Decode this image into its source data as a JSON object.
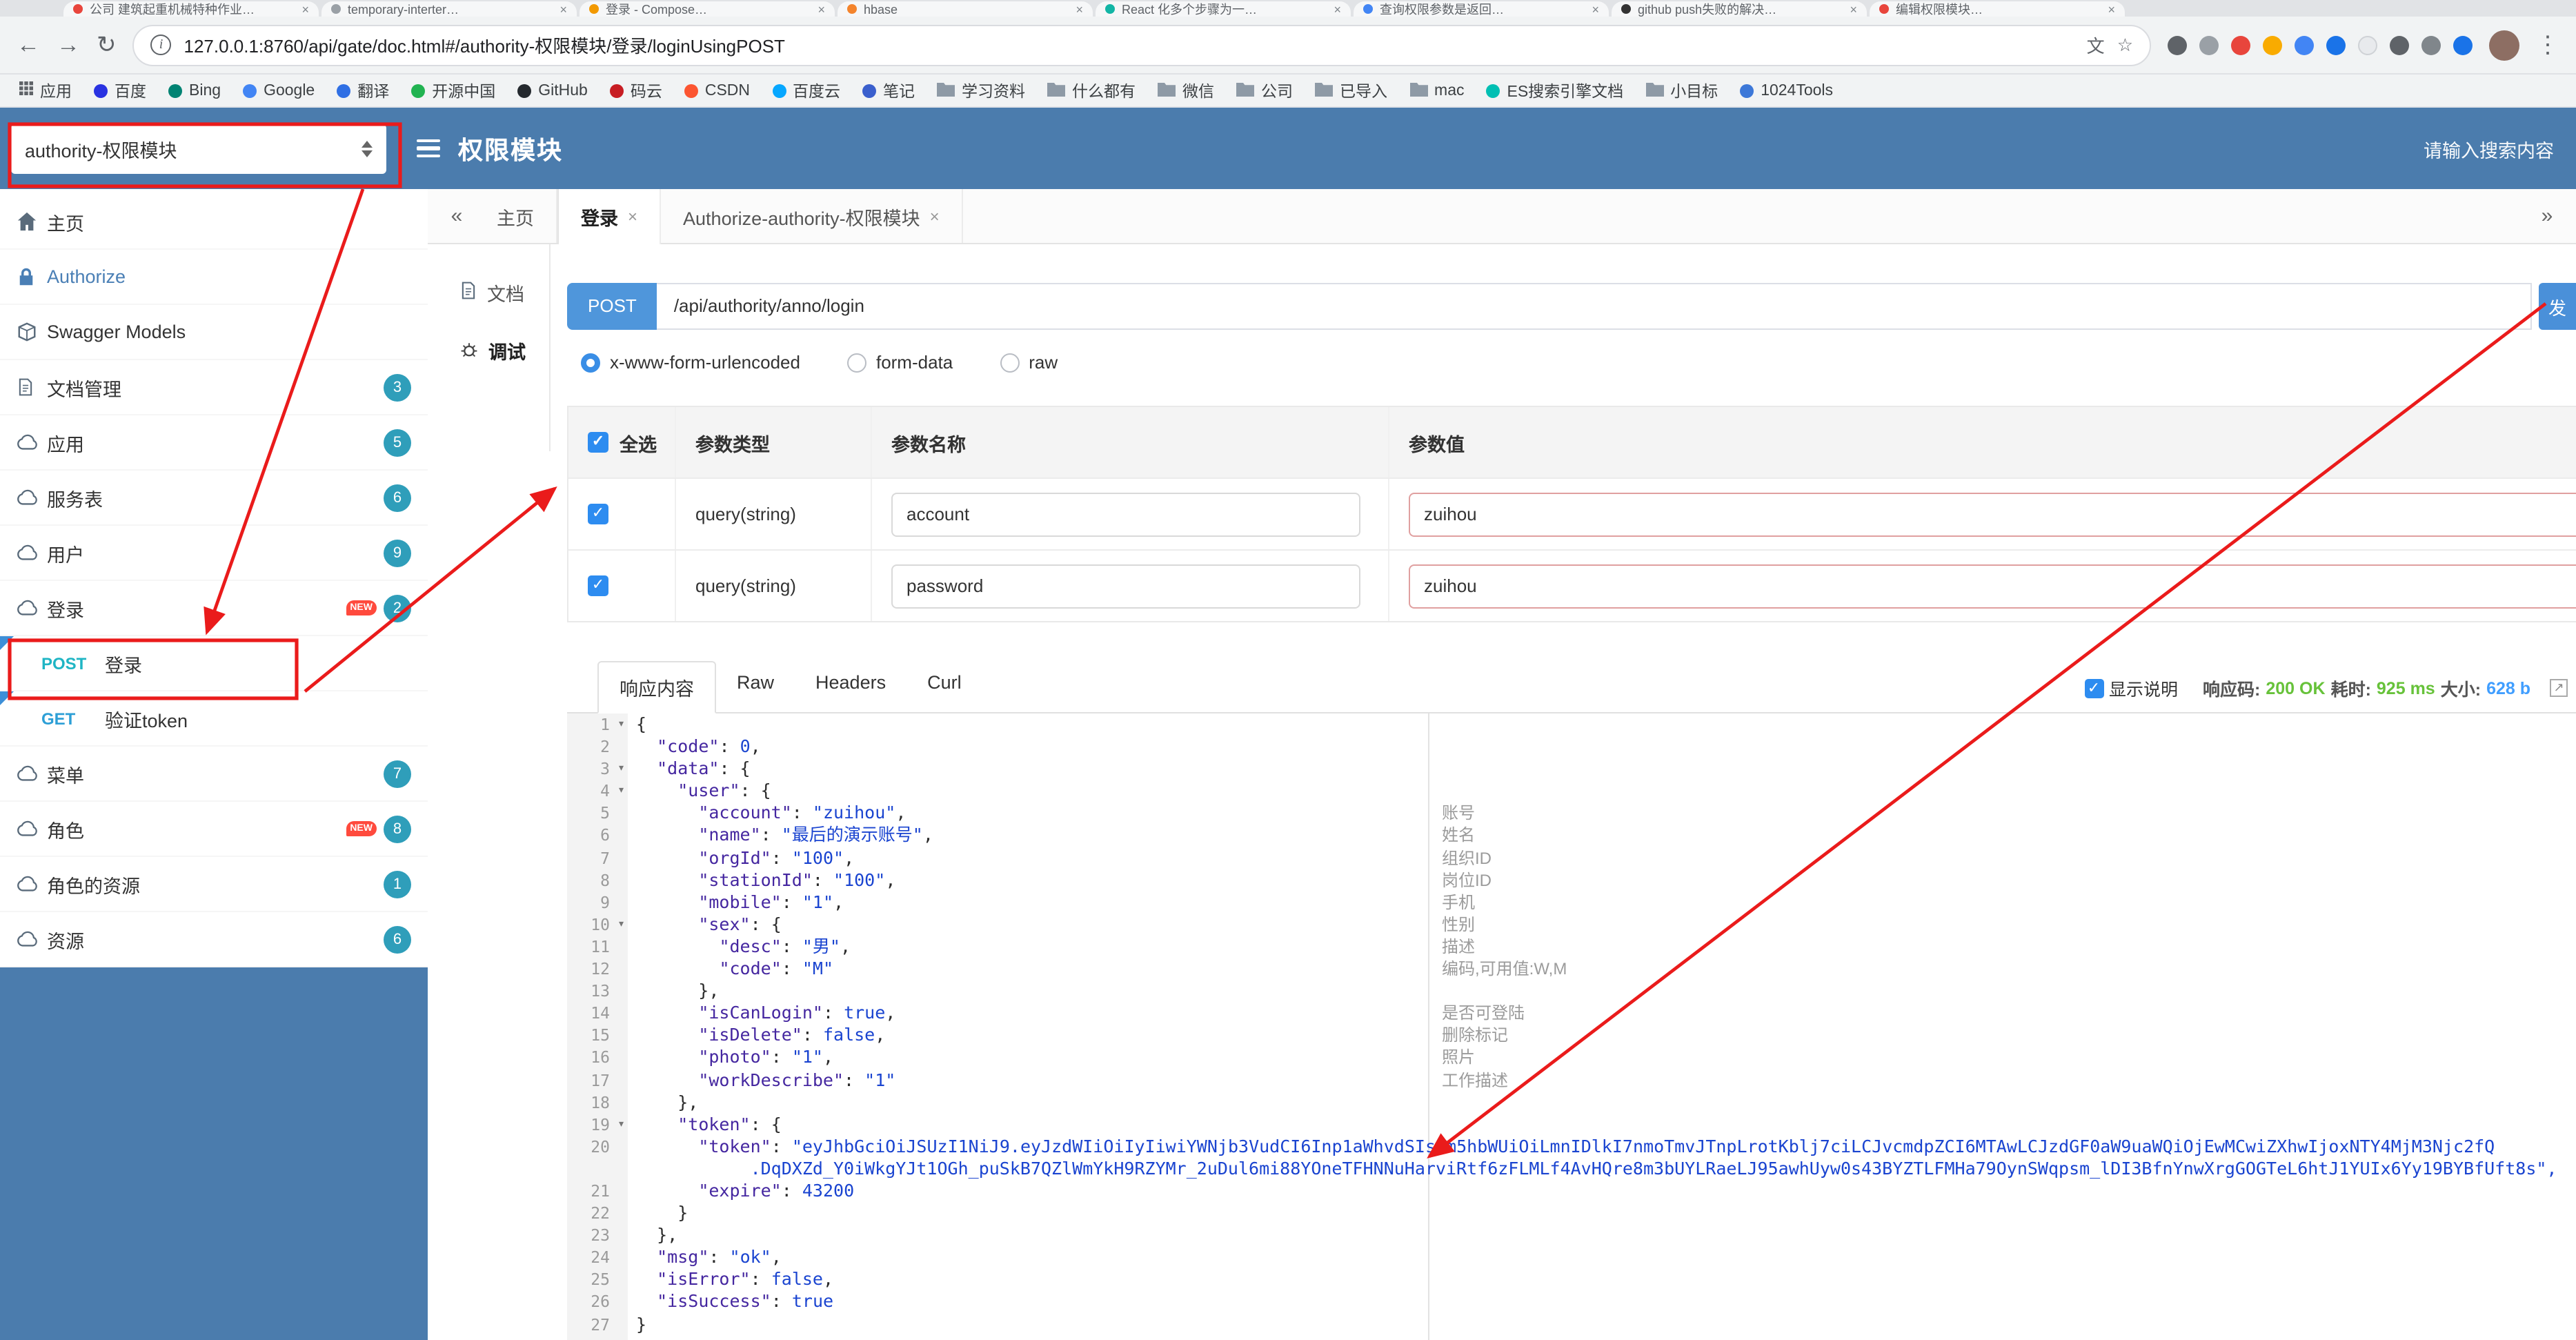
{
  "browser": {
    "tabs": [
      {
        "title": "公司 建筑起重机械特种作业…",
        "color": "#e8453c"
      },
      {
        "title": "temporary-interter…",
        "color": "#9aa0a6"
      },
      {
        "title": "登录 - Compose…",
        "color": "#f29900"
      },
      {
        "title": "hbase",
        "color": "#f4842c"
      },
      {
        "title": "React 化多个步骤为一…",
        "color": "#12b5a5"
      },
      {
        "title": "查询权限参数是返回…",
        "color": "#4285f4"
      },
      {
        "title": "github push失败的解决…",
        "color": "#333333"
      },
      {
        "title": "编辑权限模块…",
        "color": "#e8453c"
      }
    ],
    "url": "127.0.0.1:8760/api/gate/doc.html#/authority-权限模块/登录/loginUsingPOST",
    "extension_colors": [
      "#5f6368",
      "#9aa0a6",
      "#e8453c",
      "#f9ab00",
      "#4285f4",
      "#1a73e8",
      "#e8eaed",
      "#5f6368",
      "#80868b",
      "#1a73e8"
    ],
    "bookmarks": [
      {
        "label": "应用",
        "icon": "apps"
      },
      {
        "label": "百度",
        "icon": "dot",
        "color": "#2932e1"
      },
      {
        "label": "Bing",
        "icon": "dot",
        "color": "#008373"
      },
      {
        "label": "Google",
        "icon": "dot",
        "color": "#4285f4"
      },
      {
        "label": "翻译",
        "icon": "dot",
        "color": "#2f6fe4"
      },
      {
        "label": "开源中国",
        "icon": "dot",
        "color": "#21b351"
      },
      {
        "label": "GitHub",
        "icon": "dot",
        "color": "#24292e"
      },
      {
        "label": "码云",
        "icon": "dot",
        "color": "#c71d23"
      },
      {
        "label": "CSDN",
        "icon": "dot",
        "color": "#fc5531"
      },
      {
        "label": "百度云",
        "icon": "dot",
        "color": "#06a7ff"
      },
      {
        "label": "笔记",
        "icon": "dot",
        "color": "#3a5fcd"
      },
      {
        "label": "学习资料",
        "icon": "folder"
      },
      {
        "label": "什么都有",
        "icon": "folder"
      },
      {
        "label": "微信",
        "icon": "folder"
      },
      {
        "label": "公司",
        "icon": "folder"
      },
      {
        "label": "已导入",
        "icon": "folder"
      },
      {
        "label": "mac",
        "icon": "folder"
      },
      {
        "label": "ES搜索引擎文档",
        "icon": "dot",
        "color": "#00bfb3"
      },
      {
        "label": "小目标",
        "icon": "folder"
      },
      {
        "label": "1024Tools",
        "icon": "dot",
        "color": "#3c78d8"
      }
    ]
  },
  "appbar": {
    "module_select": "authority-权限模块",
    "title": "权限模块",
    "search_placeholder": "请输入搜索内容"
  },
  "sidebar": {
    "items": [
      {
        "key": "home",
        "icon": "home",
        "label": "主页"
      },
      {
        "key": "authorize",
        "icon": "lock",
        "label": "Authorize",
        "highlight": true
      },
      {
        "key": "swagger-models",
        "icon": "box",
        "label": "Swagger Models"
      },
      {
        "key": "doc-manage",
        "icon": "file",
        "label": "文档管理",
        "badge": "3"
      },
      {
        "key": "application",
        "icon": "cloud",
        "label": "应用",
        "badge": "5"
      },
      {
        "key": "service",
        "icon": "cloud",
        "label": "服务表",
        "badge": "6"
      },
      {
        "key": "user",
        "icon": "cloud",
        "label": "用户",
        "badge": "9"
      },
      {
        "key": "login",
        "icon": "cloud",
        "label": "登录",
        "badge": "2",
        "new": true
      },
      {
        "key": "post-login",
        "child": true,
        "method": "POST",
        "label": "登录"
      },
      {
        "key": "get-verify-token",
        "child": true,
        "method": "GET",
        "label": "验证token"
      },
      {
        "key": "menu",
        "icon": "cloud",
        "label": "菜单",
        "badge": "7"
      },
      {
        "key": "role",
        "icon": "cloud",
        "label": "角色",
        "badge": "8",
        "new": true
      },
      {
        "key": "role-resource",
        "icon": "cloud",
        "label": "角色的资源",
        "badge": "1"
      },
      {
        "key": "resource",
        "icon": "cloud",
        "label": "资源",
        "badge": "6"
      }
    ]
  },
  "main_tabs": {
    "collapse": "«",
    "expand": "»",
    "items": [
      {
        "label": "主页",
        "closable": false
      },
      {
        "label": "登录",
        "closable": true,
        "active": true
      },
      {
        "label": "Authorize-authority-权限模块",
        "closable": true
      }
    ]
  },
  "doc_nav": {
    "items": [
      {
        "key": "doc",
        "label": "文档",
        "icon": "file"
      },
      {
        "key": "debug",
        "label": "调试",
        "icon": "debug",
        "active": true
      }
    ]
  },
  "request": {
    "method": "POST",
    "url": "/api/authority/anno/login",
    "send_label": "发",
    "body_types": [
      "x-www-form-urlencoded",
      "form-data",
      "raw"
    ],
    "selected_body_type": "x-www-form-urlencoded"
  },
  "params": {
    "headers": [
      "全选",
      "参数类型",
      "参数名称",
      "参数值"
    ],
    "rows": [
      {
        "checked": true,
        "type": "query(string)",
        "name": "account",
        "value": "zuihou"
      },
      {
        "checked": true,
        "type": "query(string)",
        "name": "password",
        "value": "zuihou"
      }
    ]
  },
  "response": {
    "tabs": [
      "响应内容",
      "Raw",
      "Headers",
      "Curl"
    ],
    "active_tab": "响应内容",
    "show_desc_label": "显示说明",
    "show_desc_checked": true,
    "status_label": "响应码:",
    "status_value": "200 OK",
    "time_label": "耗时:",
    "time_value": "925 ms",
    "size_label": "大小:",
    "size_value": "628 b",
    "body_lines": [
      {
        "n": "1",
        "text": "{",
        "fold": true
      },
      {
        "n": "2",
        "text": "  \"code\": 0,"
      },
      {
        "n": "3",
        "text": "  \"data\": {",
        "fold": true
      },
      {
        "n": "4",
        "text": "    \"user\": {",
        "fold": true
      },
      {
        "n": "5",
        "text": "      \"account\": \"zuihou\",",
        "comment": "账号"
      },
      {
        "n": "6",
        "text": "      \"name\": \"最后的演示账号\",",
        "comment": "姓名"
      },
      {
        "n": "7",
        "text": "      \"orgId\": \"100\",",
        "comment": "组织ID"
      },
      {
        "n": "8",
        "text": "      \"stationId\": \"100\",",
        "comment": "岗位ID"
      },
      {
        "n": "9",
        "text": "      \"mobile\": \"1\",",
        "comment": "手机"
      },
      {
        "n": "10",
        "text": "      \"sex\": {",
        "fold": true,
        "comment": "性别"
      },
      {
        "n": "11",
        "text": "        \"desc\": \"男\",",
        "comment": "描述"
      },
      {
        "n": "12",
        "text": "        \"code\": \"M\"",
        "comment": "编码,可用值:W,M"
      },
      {
        "n": "13",
        "text": "      },"
      },
      {
        "n": "14",
        "text": "      \"isCanLogin\": true,",
        "comment": "是否可登陆"
      },
      {
        "n": "15",
        "text": "      \"isDelete\": false,",
        "comment": "删除标记"
      },
      {
        "n": "16",
        "text": "      \"photo\": \"1\",",
        "comment": "照片"
      },
      {
        "n": "17",
        "text": "      \"workDescribe\": \"1\"",
        "comment": "工作描述"
      },
      {
        "n": "18",
        "text": "    },"
      },
      {
        "n": "19",
        "text": "    \"token\": {",
        "fold": true
      },
      {
        "n": "20",
        "text": "      \"token\": \"eyJhbGciOiJSUzI1NiJ9.eyJzdWIiOiIyIiwiYWNjb3VudCI6Inp1aWhvdSIsIm5hbWUiOiLmnIDlkI7nmoTmvJTnpLrotKblj7ciLCJvcmdpZCI6MTAwLCJzdGF0aW9uaWQiOjEwMCwiZXhwIjoxNTY4MjM3Njc2fQ"
      },
      {
        "n": "",
        "wrap": true,
        "text": "           .DqDXZd_Y0iWkgYJt1OGh_puSkB7QZlWmYkH9RZYMr_2uDul6mi88YOneTFHNNuHarviRtf6zFLMLf4AvHQre8m3bUYLRaeLJ95awhUyw0s43BYZTLFMHa79OynSWqpsm_lDI3BfnYnwXrgGOGTeL6htJ1YUIx6Yy19BYBfUft8s\","
      },
      {
        "n": "21",
        "text": "      \"expire\": 43200"
      },
      {
        "n": "22",
        "text": "    }"
      },
      {
        "n": "23",
        "text": "  },"
      },
      {
        "n": "24",
        "text": "  \"msg\": \"ok\","
      },
      {
        "n": "25",
        "text": "  \"isError\": false,"
      },
      {
        "n": "26",
        "text": "  \"isSuccess\": true"
      },
      {
        "n": "27",
        "text": "}"
      }
    ]
  },
  "colors": {
    "header_blue": "#4b7cad",
    "annotation_red": "#ea1b1b",
    "method_post": "#1fb5c4",
    "method_get": "#2d9fd6",
    "badge": "#2f9eba",
    "status_green": "#67c23a",
    "size_blue": "#409eff"
  }
}
